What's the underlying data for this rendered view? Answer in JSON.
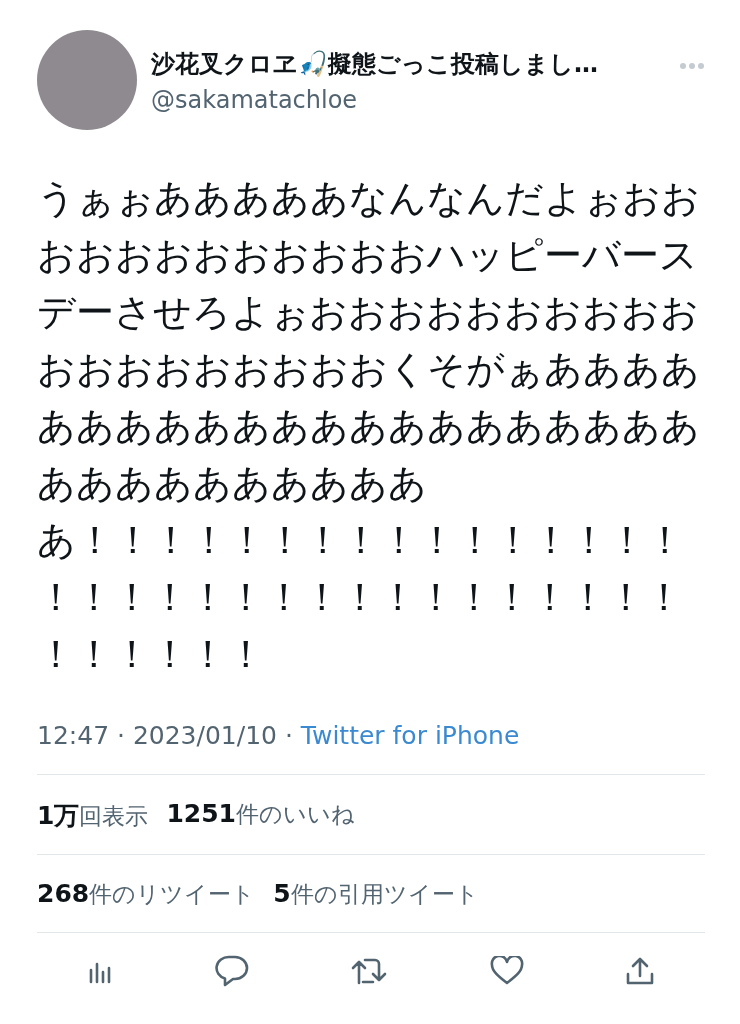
{
  "tweet": {
    "display_name": "沙花叉クロヱ🎣擬態ごっこ投稿しまし…",
    "handle": "@sakamatachloe",
    "lines": [
      "うぁぉあああああなんなんだよぉおお",
      "おおおおおおおおおおハッピーバース",
      "デーさせろよぉおおおおおおおおおお",
      "おおおおおおおおおくそがぁああああ",
      "あああああああああああああああああ",
      "ああああああああああ",
      "あ！！！！！！！！！！！！！！！！",
      "！！！！！！！！！！！！！！！！！",
      "！！！！！！"
    ],
    "timestamp": "12:47 · 2023/01/10 · ",
    "source": "Twitter for iPhone"
  },
  "stats": [
    [
      "**1万**回表示",
      "**1251**件のいいね"
    ],
    [
      "**268**件のリツイート",
      "**5**件の引用ツイート"
    ]
  ],
  "actions": [
    {
      "kind": "views"
    },
    {
      "kind": "reply"
    },
    {
      "kind": "retweet"
    },
    {
      "kind": "like"
    },
    {
      "kind": "share"
    }
  ]
}
